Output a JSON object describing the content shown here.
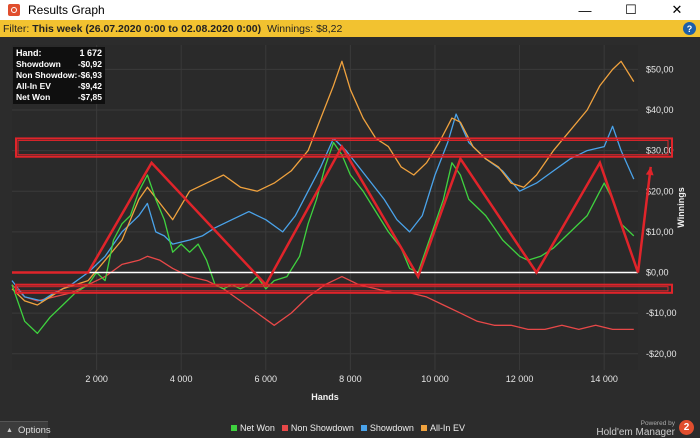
{
  "window": {
    "title": "Results Graph",
    "minimize": "—",
    "maximize": "☐",
    "close": "✕"
  },
  "filter": {
    "label": "Filter:",
    "range": "This week (26.07.2020 0:00 to 02.08.2020 0:00)",
    "winnings": "Winnings: $8,22",
    "help": "?"
  },
  "stats": [
    {
      "label": "Hand:",
      "value": "1 672"
    },
    {
      "label": "Showdown",
      "value": "-$0,92"
    },
    {
      "label": "Non Showdow:",
      "value": "-$6,93"
    },
    {
      "label": "All-In EV",
      "value": "-$9,42"
    },
    {
      "label": "Net Won",
      "value": "-$7,85"
    }
  ],
  "bottom": {
    "options": "Options",
    "powered": "Powered by",
    "brand": "Hold'em Manager",
    "brand_badge": "2"
  },
  "colors": {
    "net_won": "#3fd23f",
    "non_showdown": "#e84848",
    "showdown": "#4aa3ea",
    "all_in_ev": "#f0a23e",
    "annotation": "#e0242a",
    "zero_line": "#ffffff",
    "grid": "#3a3a3a"
  },
  "chart_data": {
    "type": "line",
    "xlabel": "Hands",
    "ylabel": "Winnings",
    "xlim": [
      0,
      14800
    ],
    "ylim": [
      -24,
      56
    ],
    "x_ticks": [
      2000,
      4000,
      6000,
      8000,
      10000,
      12000,
      14000
    ],
    "x_tick_labels": [
      "2 000",
      "4 000",
      "6 000",
      "8 000",
      "10 000",
      "12 000",
      "14 000"
    ],
    "y_ticks": [
      -20,
      -10,
      0,
      10,
      20,
      30,
      40,
      50
    ],
    "y_tick_labels": [
      "-$20,00",
      "-$10,00",
      "$0,00",
      "$10,00",
      "$20,00",
      "$30,00",
      "$40,00",
      "$50,00"
    ],
    "grid": true,
    "legend_position": "bottom",
    "series": [
      {
        "name": "Net Won",
        "color": "#3fd23f",
        "points": [
          [
            0,
            -3
          ],
          [
            300,
            -12
          ],
          [
            600,
            -15
          ],
          [
            900,
            -11
          ],
          [
            1200,
            -8
          ],
          [
            1500,
            -5
          ],
          [
            1800,
            -3
          ],
          [
            2000,
            0
          ],
          [
            2200,
            -2
          ],
          [
            2400,
            8
          ],
          [
            2600,
            12
          ],
          [
            2800,
            14
          ],
          [
            3000,
            20
          ],
          [
            3200,
            24
          ],
          [
            3400,
            18
          ],
          [
            3600,
            13
          ],
          [
            3800,
            5
          ],
          [
            4000,
            7
          ],
          [
            4200,
            5
          ],
          [
            4400,
            7
          ],
          [
            4600,
            3
          ],
          [
            4800,
            -3
          ],
          [
            5000,
            -4
          ],
          [
            5200,
            -3
          ],
          [
            5400,
            -4
          ],
          [
            5600,
            -3
          ],
          [
            5800,
            -1
          ],
          [
            6000,
            -4
          ],
          [
            6200,
            -2
          ],
          [
            6500,
            -1
          ],
          [
            6800,
            4
          ],
          [
            7000,
            12
          ],
          [
            7200,
            18
          ],
          [
            7400,
            26
          ],
          [
            7600,
            32
          ],
          [
            7800,
            29
          ],
          [
            8000,
            24
          ],
          [
            8300,
            20
          ],
          [
            8600,
            15
          ],
          [
            8900,
            10
          ],
          [
            9200,
            6
          ],
          [
            9400,
            1
          ],
          [
            9600,
            0
          ],
          [
            9800,
            6
          ],
          [
            10000,
            12
          ],
          [
            10200,
            18
          ],
          [
            10400,
            27
          ],
          [
            10600,
            24
          ],
          [
            10800,
            18
          ],
          [
            11000,
            16
          ],
          [
            11200,
            14
          ],
          [
            11400,
            11
          ],
          [
            11600,
            8
          ],
          [
            11800,
            6
          ],
          [
            12000,
            4
          ],
          [
            12200,
            3
          ],
          [
            12500,
            4
          ],
          [
            12800,
            6
          ],
          [
            13200,
            10
          ],
          [
            13600,
            14
          ],
          [
            13900,
            20
          ],
          [
            14000,
            22
          ],
          [
            14200,
            18
          ],
          [
            14400,
            12
          ],
          [
            14700,
            9
          ]
        ]
      },
      {
        "name": "Non Showdown",
        "color": "#e84848",
        "points": [
          [
            0,
            -3
          ],
          [
            300,
            -6
          ],
          [
            600,
            -7
          ],
          [
            1000,
            -6
          ],
          [
            1400,
            -5
          ],
          [
            1800,
            -3
          ],
          [
            2200,
            -1
          ],
          [
            2600,
            2
          ],
          [
            3000,
            3
          ],
          [
            3200,
            4
          ],
          [
            3500,
            3
          ],
          [
            3800,
            1
          ],
          [
            4200,
            -1
          ],
          [
            4600,
            -2
          ],
          [
            5000,
            -4
          ],
          [
            5400,
            -7
          ],
          [
            5800,
            -10
          ],
          [
            6200,
            -13
          ],
          [
            6600,
            -10
          ],
          [
            7000,
            -6
          ],
          [
            7400,
            -3
          ],
          [
            7800,
            -1
          ],
          [
            8200,
            -3
          ],
          [
            8600,
            -4
          ],
          [
            9000,
            -5
          ],
          [
            9400,
            -5
          ],
          [
            9800,
            -6
          ],
          [
            10200,
            -8
          ],
          [
            10600,
            -10
          ],
          [
            11000,
            -12
          ],
          [
            11400,
            -13
          ],
          [
            11800,
            -13
          ],
          [
            12200,
            -14
          ],
          [
            12600,
            -14
          ],
          [
            13000,
            -13
          ],
          [
            13400,
            -14
          ],
          [
            13800,
            -13
          ],
          [
            14200,
            -14
          ],
          [
            14700,
            -14
          ]
        ]
      },
      {
        "name": "Showdown",
        "color": "#4aa3ea",
        "points": [
          [
            0,
            -2
          ],
          [
            300,
            -6
          ],
          [
            700,
            -7
          ],
          [
            1000,
            -5
          ],
          [
            1400,
            -3
          ],
          [
            1800,
            0
          ],
          [
            2200,
            4
          ],
          [
            2600,
            10
          ],
          [
            2800,
            12
          ],
          [
            3000,
            14
          ],
          [
            3200,
            17
          ],
          [
            3400,
            10
          ],
          [
            3600,
            9
          ],
          [
            3800,
            7
          ],
          [
            4200,
            8
          ],
          [
            4500,
            9
          ],
          [
            4800,
            11
          ],
          [
            5200,
            13
          ],
          [
            5600,
            15
          ],
          [
            6000,
            13
          ],
          [
            6400,
            10
          ],
          [
            6700,
            14
          ],
          [
            7000,
            20
          ],
          [
            7300,
            26
          ],
          [
            7600,
            33
          ],
          [
            7900,
            30
          ],
          [
            8200,
            26
          ],
          [
            8500,
            22
          ],
          [
            8800,
            18
          ],
          [
            9100,
            13
          ],
          [
            9400,
            10
          ],
          [
            9700,
            14
          ],
          [
            10000,
            24
          ],
          [
            10300,
            32
          ],
          [
            10500,
            39
          ],
          [
            10800,
            32
          ],
          [
            11200,
            28
          ],
          [
            11600,
            25
          ],
          [
            12000,
            20
          ],
          [
            12400,
            22
          ],
          [
            12800,
            25
          ],
          [
            13200,
            28
          ],
          [
            13600,
            30
          ],
          [
            14000,
            31
          ],
          [
            14200,
            36
          ],
          [
            14400,
            30
          ],
          [
            14700,
            23
          ]
        ]
      },
      {
        "name": "All-In EV",
        "color": "#f0a23e",
        "points": [
          [
            0,
            -4
          ],
          [
            300,
            -7
          ],
          [
            600,
            -8
          ],
          [
            900,
            -6
          ],
          [
            1200,
            -4
          ],
          [
            1500,
            -3
          ],
          [
            1800,
            -2
          ],
          [
            2200,
            3
          ],
          [
            2600,
            8
          ],
          [
            3000,
            18
          ],
          [
            3200,
            21
          ],
          [
            3500,
            17
          ],
          [
            3800,
            13
          ],
          [
            4200,
            20
          ],
          [
            4600,
            22
          ],
          [
            5000,
            24
          ],
          [
            5400,
            21
          ],
          [
            5800,
            20
          ],
          [
            6200,
            22
          ],
          [
            6600,
            25
          ],
          [
            7000,
            30
          ],
          [
            7300,
            38
          ],
          [
            7600,
            46
          ],
          [
            7800,
            52
          ],
          [
            8000,
            45
          ],
          [
            8300,
            38
          ],
          [
            8600,
            33
          ],
          [
            8900,
            31
          ],
          [
            9200,
            26
          ],
          [
            9500,
            24
          ],
          [
            9800,
            27
          ],
          [
            10100,
            32
          ],
          [
            10400,
            38
          ],
          [
            10600,
            37
          ],
          [
            10900,
            31
          ],
          [
            11200,
            28
          ],
          [
            11500,
            26
          ],
          [
            11800,
            22
          ],
          [
            12100,
            21
          ],
          [
            12400,
            24
          ],
          [
            12800,
            30
          ],
          [
            13200,
            35
          ],
          [
            13600,
            40
          ],
          [
            13900,
            46
          ],
          [
            14200,
            50
          ],
          [
            14400,
            52
          ],
          [
            14700,
            47
          ]
        ]
      }
    ],
    "annotations": {
      "horizontal_bands": [
        [
          28.5,
          33
        ],
        [
          -5,
          -3
        ]
      ],
      "zigzag": [
        [
          0,
          0
        ],
        [
          1800,
          0
        ],
        [
          3300,
          27
        ],
        [
          6000,
          -3
        ],
        [
          7800,
          31
        ],
        [
          9600,
          -1
        ],
        [
          10600,
          28
        ],
        [
          12400,
          0
        ],
        [
          13900,
          27
        ],
        [
          14800,
          0
        ],
        [
          15100,
          26
        ]
      ]
    }
  }
}
